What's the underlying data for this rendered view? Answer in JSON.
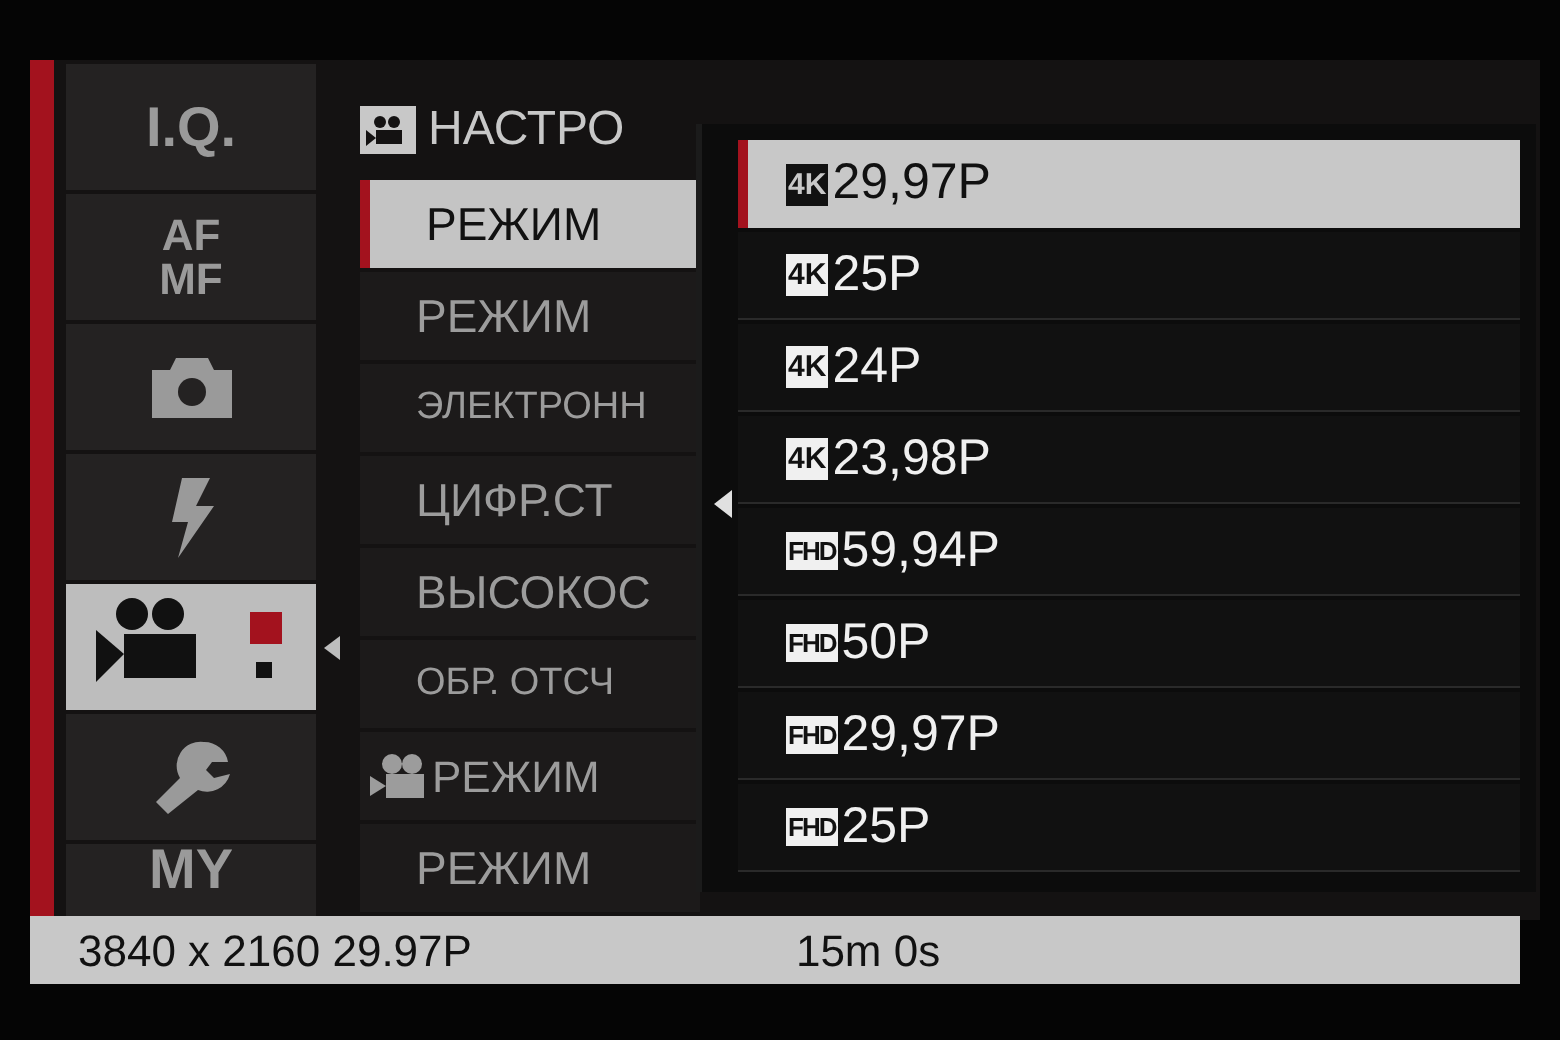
{
  "sidebar": {
    "items": [
      {
        "kind": "text",
        "lines": [
          "I.Q."
        ],
        "selected": false
      },
      {
        "kind": "text",
        "lines": [
          "AF",
          "MF"
        ],
        "selected": false
      },
      {
        "kind": "camera",
        "selected": false
      },
      {
        "kind": "flash",
        "selected": false
      },
      {
        "kind": "movie",
        "selected": true
      },
      {
        "kind": "wrench",
        "selected": false
      },
      {
        "kind": "text",
        "lines": [
          "MY"
        ],
        "selected": false
      }
    ]
  },
  "menu": {
    "title": "НАСТРО",
    "items": [
      {
        "kind": "plain",
        "label": "РЕЖИМ",
        "selected": true
      },
      {
        "kind": "plain",
        "label": "РЕЖИМ",
        "selected": false
      },
      {
        "kind": "small",
        "label": "ЭЛЕКТРОНН",
        "selected": false
      },
      {
        "kind": "plain",
        "label": "ЦИФР.СТ",
        "selected": false
      },
      {
        "kind": "plain",
        "label": "ВЫСОКОС",
        "selected": false
      },
      {
        "kind": "small",
        "label": "ОБР. ОТСЧ",
        "selected": false
      },
      {
        "kind": "movie",
        "label": "РЕЖИМ",
        "selected": false
      },
      {
        "kind": "plain",
        "label": "РЕЖИМ",
        "selected": false
      }
    ]
  },
  "popup": {
    "options": [
      {
        "format": "4K",
        "rate": "29,97P",
        "selected": true
      },
      {
        "format": "4K",
        "rate": "25P",
        "selected": false
      },
      {
        "format": "4K",
        "rate": "24P",
        "selected": false
      },
      {
        "format": "4K",
        "rate": "23,98P",
        "selected": false
      },
      {
        "format": "FHD",
        "rate": "59,94P",
        "selected": false
      },
      {
        "format": "FHD",
        "rate": "50P",
        "selected": false
      },
      {
        "format": "FHD",
        "rate": "29,97P",
        "selected": false
      },
      {
        "format": "FHD",
        "rate": "25P",
        "selected": false
      }
    ]
  },
  "status_bar": {
    "resolution": "3840 x 2160 29.97P",
    "time": "15m 0s"
  }
}
